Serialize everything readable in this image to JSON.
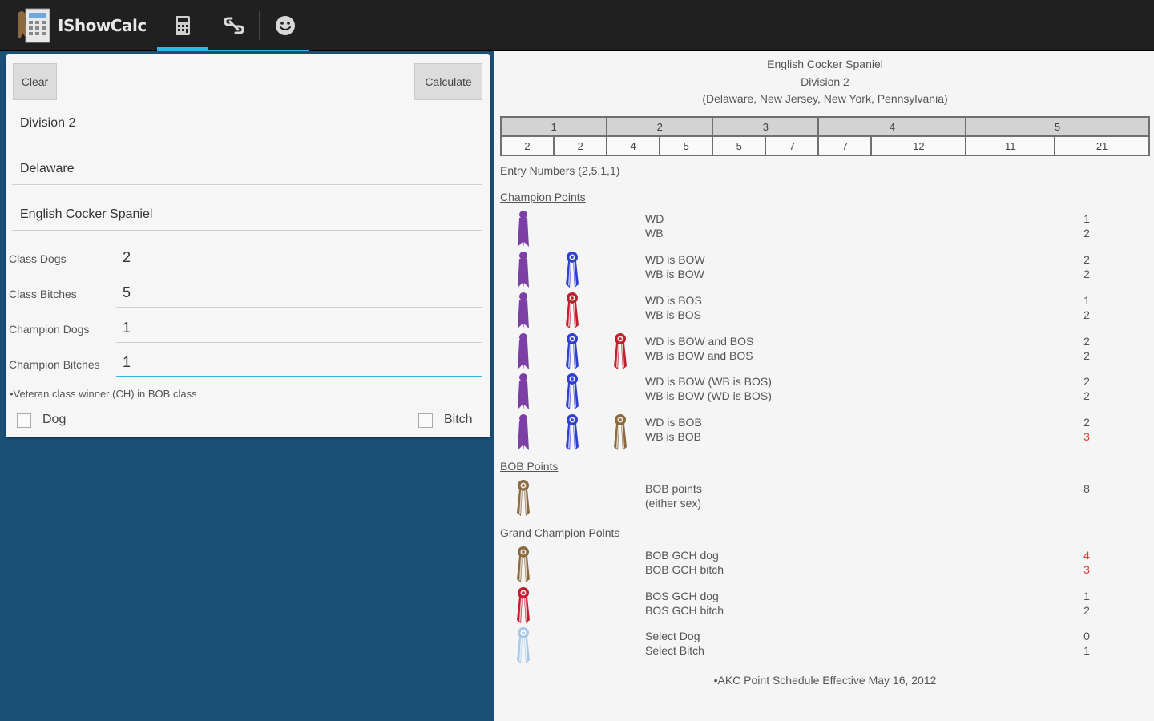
{
  "app": {
    "title": "IShowCalc",
    "logo": "dog-show-app-logo"
  },
  "tabs": [
    {
      "icon": "calculator-icon",
      "selected": true
    },
    {
      "icon": "link-icon",
      "selected": false
    },
    {
      "icon": "smiley-icon",
      "selected": false
    }
  ],
  "form": {
    "clear_label": "Clear",
    "calculate_label": "Calculate",
    "division": "Division 2",
    "state": "Delaware",
    "breed": "English Cocker Spaniel",
    "class_dogs_label": "Class Dogs",
    "class_dogs": "2",
    "class_bitches_label": "Class Bitches",
    "class_bitches": "5",
    "champion_dogs_label": "Champion Dogs",
    "champion_dogs": "1",
    "champion_bitches_label": "Champion Bitches",
    "champion_bitches": "1",
    "veteran_note": "•Veteran class winner (CH) in BOB class",
    "dog_label": "Dog",
    "bitch_label": "Bitch",
    "dog_checked": false,
    "bitch_checked": false
  },
  "results": {
    "breed": "English Cocker Spaniel",
    "division": "Division 2",
    "states": "(Delaware, New Jersey, New York, Pennsylvania)",
    "point_levels": [
      "1",
      "2",
      "3",
      "4",
      "5"
    ],
    "entry_counts": [
      "2",
      "2",
      "4",
      "5",
      "5",
      "7",
      "7",
      "12",
      "11",
      "21"
    ],
    "entry_numbers": "Entry Numbers (2,5,1,1)",
    "champion_points_title": "Champion Points",
    "champion_rows": [
      {
        "ribbons": [
          "purple"
        ],
        "line1": "WD",
        "line2": "WB",
        "p1": "1",
        "p2": "2",
        "p1_red": false,
        "p2_red": false
      },
      {
        "ribbons": [
          "purple",
          "blue"
        ],
        "line1": "WD is BOW",
        "line2": "WB is BOW",
        "p1": "2",
        "p2": "2",
        "p1_red": false,
        "p2_red": false
      },
      {
        "ribbons": [
          "purple",
          "red"
        ],
        "line1": "WD is BOS",
        "line2": "WB is BOS",
        "p1": "1",
        "p2": "2",
        "p1_red": false,
        "p2_red": false
      },
      {
        "ribbons": [
          "purple",
          "blue",
          "red"
        ],
        "line1": "WD is BOW and BOS",
        "line2": "WB is BOW and BOS",
        "p1": "2",
        "p2": "2",
        "p1_red": false,
        "p2_red": false
      },
      {
        "ribbons": [
          "purple",
          "blue"
        ],
        "line1": "WD is BOW (WB is BOS)",
        "line2": "WB is BOW (WD is BOS)",
        "p1": "2",
        "p2": "2",
        "p1_red": false,
        "p2_red": false
      },
      {
        "ribbons": [
          "purple",
          "blue",
          "brown"
        ],
        "line1": "WD is BOB",
        "line2": "WB is BOB",
        "p1": "2",
        "p2": "3",
        "p1_red": false,
        "p2_red": true
      }
    ],
    "bob_points_title": "BOB Points",
    "bob_row": {
      "line1": "BOB points",
      "line2": " (either sex)",
      "p1": "8"
    },
    "grand_champion_title": "Grand Champion Points",
    "gch_rows": [
      {
        "ribbon": "brown",
        "line1": "BOB GCH dog",
        "line2": "BOB GCH bitch",
        "p1": "4",
        "p2": "3",
        "p1_red": true,
        "p2_red": true
      },
      {
        "ribbon": "red",
        "line1": "BOS GCH dog",
        "line2": "BOS GCH bitch",
        "p1": "1",
        "p2": "2",
        "p1_red": false,
        "p2_red": false
      },
      {
        "ribbon": "lightblue",
        "line1": "Select Dog",
        "line2": "Select Bitch",
        "p1": "0",
        "p2": "1",
        "p1_red": false,
        "p2_red": false
      }
    ],
    "footnote": "•AKC Point Schedule Effective May 16, 2012"
  },
  "colors": {
    "actionbar": "#202020",
    "accent": "#33b5e5",
    "left_background": "#1b4f76",
    "ribbon_purple": "#7b3fa6",
    "ribbon_blue": "#2e3fd1",
    "ribbon_red": "#c21f2e",
    "ribbon_brown": "#8a6a3e",
    "ribbon_lightblue": "#a8c8ea",
    "points_red": "#e53935"
  }
}
